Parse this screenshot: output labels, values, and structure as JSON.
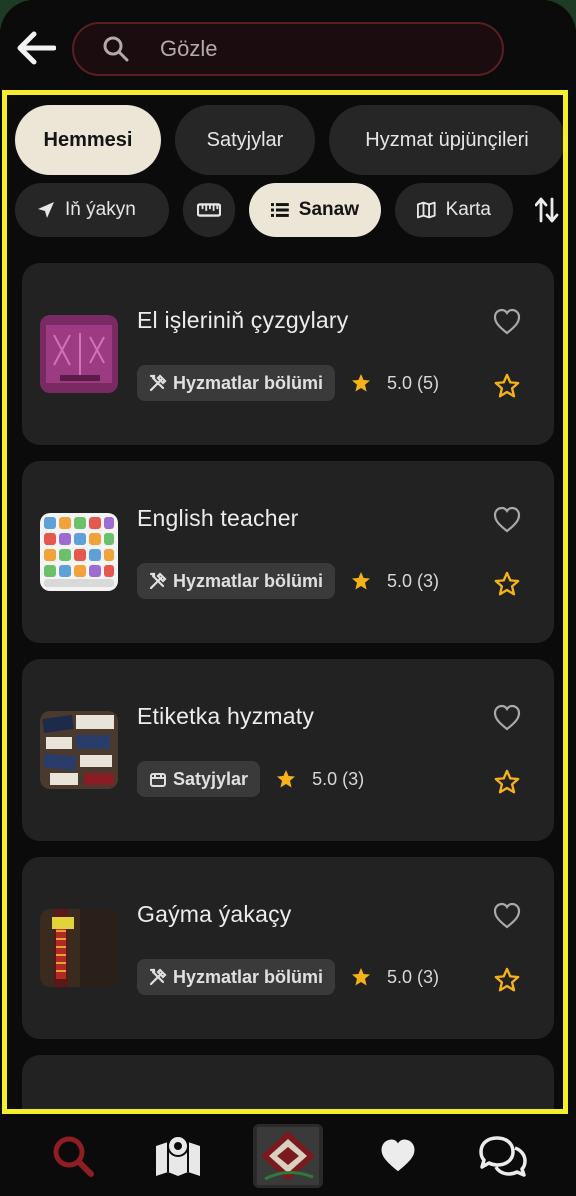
{
  "search": {
    "placeholder": "Gözle"
  },
  "filters": {
    "tabs": [
      {
        "label": "Hemmesi",
        "active": true
      },
      {
        "label": "Satyjylar",
        "active": false
      },
      {
        "label": "Hyzmat üpjünçileri",
        "active": false
      }
    ],
    "view": {
      "nearest_label": "Iň ýakyn",
      "list_label": "Sanaw",
      "map_label": "Karta"
    }
  },
  "items": [
    {
      "title": "El işleriniň çyzgylary",
      "tag": "Hyzmatlar bölümi",
      "tag_icon": "tools-icon",
      "rating": "5.0 (5)",
      "thumb": "embroidery"
    },
    {
      "title": "English teacher",
      "tag": "Hyzmatlar bölümi",
      "tag_icon": "tools-icon",
      "rating": "5.0 (3)",
      "thumb": "stickers"
    },
    {
      "title": "Etiketka hyzmaty",
      "tag": "Satyjylar",
      "tag_icon": "store-icon",
      "rating": "5.0 (3)",
      "thumb": "labels"
    },
    {
      "title": "Gaýma ýakaçy",
      "tag": "Hyzmatlar bölümi",
      "tag_icon": "tools-icon",
      "rating": "5.0 (3)",
      "thumb": "collar"
    }
  ],
  "colors": {
    "accent": "#ece6d6",
    "frame": "#f5ee2a",
    "star": "#f5b21b",
    "search_border": "#5a1d22",
    "nav_active": "#8f1d24"
  },
  "nav": [
    "search-icon",
    "map-icon",
    "home-logo",
    "heart-icon",
    "chat-icon"
  ]
}
